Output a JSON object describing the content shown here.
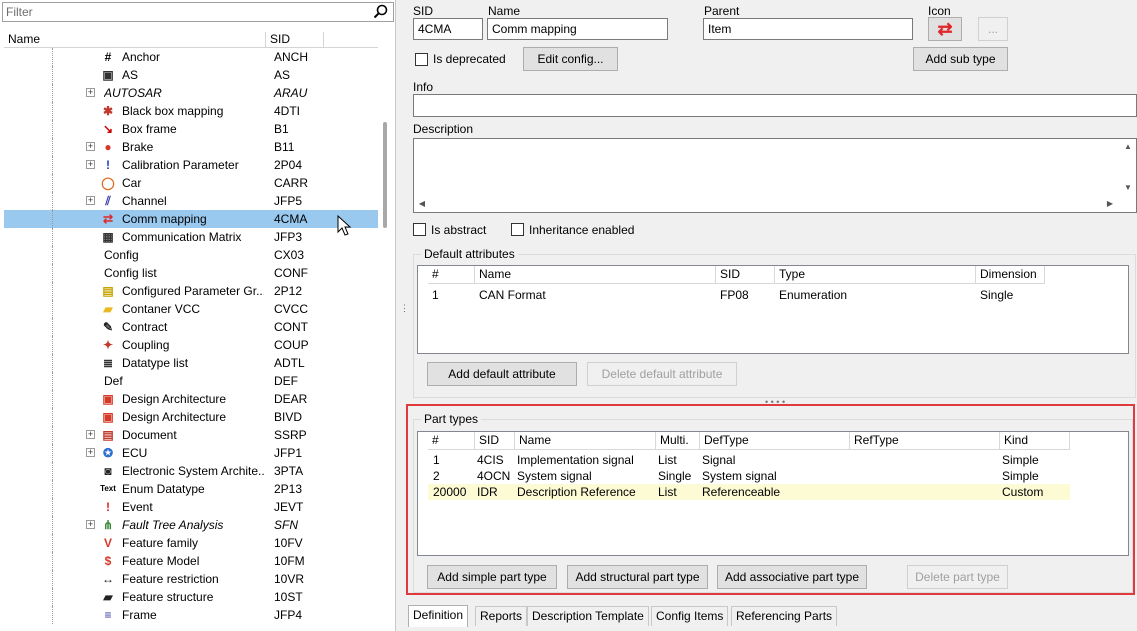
{
  "filter": {
    "placeholder": "Filter"
  },
  "tree": {
    "headers": {
      "name": "Name",
      "sid": "SID"
    },
    "rows": [
      {
        "name": "Anchor",
        "sid": "ANCH",
        "icon": "hash-icon",
        "glyph": "#",
        "color": "#000000"
      },
      {
        "name": "AS",
        "sid": "AS",
        "icon": "pano-icon",
        "glyph": "▣",
        "color": "#333333"
      },
      {
        "name": "AUTOSAR",
        "sid": "ARAU",
        "icon": "",
        "glyph": "",
        "color": "#000000"
      },
      {
        "name": "Black box mapping",
        "sid": "4DTI",
        "icon": "black-box-mapping-icon",
        "glyph": "✱",
        "color": "#c0392b"
      },
      {
        "name": "Box frame",
        "sid": "B1",
        "icon": "box-frame-icon",
        "glyph": "↘",
        "color": "#cc0000"
      },
      {
        "name": "Brake",
        "sid": "B11",
        "icon": "brake-icon",
        "glyph": "●",
        "color": "#d63a2b"
      },
      {
        "name": "Calibration Parameter",
        "sid": "2P04",
        "icon": "exclamation-icon",
        "glyph": "!",
        "color": "#1f3fbf"
      },
      {
        "name": "Car",
        "sid": "CARR",
        "icon": "car-icon",
        "glyph": "◯",
        "color": "#e2691f"
      },
      {
        "name": "Channel",
        "sid": "JFP5",
        "icon": "channel-icon",
        "glyph": "⫽",
        "color": "#3a3aa8"
      },
      {
        "name": "Comm mapping",
        "sid": "4CMA",
        "icon": "swap-arrows-icon",
        "glyph": "⇄",
        "color": "#e0262b"
      },
      {
        "name": "Communication Matrix",
        "sid": "JFP3",
        "icon": "communication-matrix-icon",
        "glyph": "▦",
        "color": "#333333"
      },
      {
        "name": "Config",
        "sid": "CX03",
        "icon": "",
        "glyph": "",
        "color": "#000000"
      },
      {
        "name": "Config list",
        "sid": "CONF",
        "icon": "",
        "glyph": "",
        "color": "#000000"
      },
      {
        "name": "Configured Parameter Gr...",
        "sid": "2P12",
        "icon": "configured-parameter-group-icon",
        "glyph": "▤",
        "color": "#c9a400"
      },
      {
        "name": "Contaner VCC",
        "sid": "CVCC",
        "icon": "folder-icon",
        "glyph": "▰",
        "color": "#e8b923"
      },
      {
        "name": "Contract",
        "sid": "CONT",
        "icon": "pen-icon",
        "glyph": "✎",
        "color": "#222222"
      },
      {
        "name": "Coupling",
        "sid": "COUP",
        "icon": "coupling-icon",
        "glyph": "✦",
        "color": "#c0392b"
      },
      {
        "name": "Datatype list",
        "sid": "ADTL",
        "icon": "datatype-list-icon",
        "glyph": "≣",
        "color": "#333333"
      },
      {
        "name": "Def",
        "sid": "DEF",
        "icon": "",
        "glyph": "",
        "color": "#000000"
      },
      {
        "name": "Design Architecture",
        "sid": "DEAR",
        "icon": "design-architecture-icon",
        "glyph": "▣",
        "color": "#d63a2b"
      },
      {
        "name": "Design Architecture",
        "sid": "BIVD",
        "icon": "design-architecture-icon",
        "glyph": "▣",
        "color": "#d63a2b"
      },
      {
        "name": "Document",
        "sid": "SSRP",
        "icon": "document-icon",
        "glyph": "▤",
        "color": "#c0392b"
      },
      {
        "name": "ECU",
        "sid": "JFP1",
        "icon": "ecu-icon",
        "glyph": "✪",
        "color": "#2b6fce"
      },
      {
        "name": "Electronic System Archite...",
        "sid": "3PTA",
        "icon": "camera-icon",
        "glyph": "◙",
        "color": "#222222"
      },
      {
        "name": "Enum Datatype",
        "sid": "2P13",
        "icon": "text-icon",
        "glyph": "Text",
        "color": "#000000"
      },
      {
        "name": "Event",
        "sid": "JEVT",
        "icon": "exclamation-icon",
        "glyph": "!",
        "color": "#e0262b"
      },
      {
        "name": "Fault Tree Analysis",
        "sid": "SFN",
        "icon": "fault-tree-icon",
        "glyph": "⋔",
        "color": "#3a8a3a"
      },
      {
        "name": "Feature family",
        "sid": "10FV",
        "icon": "feature-family-icon",
        "glyph": "V",
        "color": "#d63a2b"
      },
      {
        "name": "Feature Model",
        "sid": "10FM",
        "icon": "feature-model-icon",
        "glyph": "$",
        "color": "#d63a2b"
      },
      {
        "name": "Feature restriction",
        "sid": "10VR",
        "icon": "double-arrow-icon",
        "glyph": "↔",
        "color": "#222222"
      },
      {
        "name": "Feature structure",
        "sid": "10ST",
        "icon": "folder-icon",
        "glyph": "▰",
        "color": "#222222"
      },
      {
        "name": "Frame",
        "sid": "JFP4",
        "icon": "frame-icon",
        "glyph": "≡",
        "color": "#3a3aa8"
      }
    ]
  },
  "form": {
    "sid_label": "SID",
    "sid_value": "4CMA",
    "name_label": "Name",
    "name_value": "Comm mapping",
    "parent_label": "Parent",
    "parent_value": "Item",
    "icon_label": "Icon",
    "icon_glyph": "⇄",
    "icon_color": "#e0262b",
    "browse_label": "...",
    "is_deprecated": "Is deprecated",
    "edit_config": "Edit config...",
    "add_sub_type": "Add sub type",
    "info_label": "Info",
    "description_label": "Description",
    "is_abstract": "Is abstract",
    "inheritance_enabled": "Inheritance enabled"
  },
  "default_attributes": {
    "title": "Default attributes",
    "headers": [
      "#",
      "Name",
      "SID",
      "Type",
      "Dimension"
    ],
    "rows": [
      [
        "1",
        "CAN Format",
        "FP08",
        "Enumeration",
        "Single"
      ]
    ],
    "add_button": "Add default attribute",
    "delete_button": "Delete default attribute"
  },
  "part_types": {
    "title": "Part types",
    "headers": [
      "#",
      "SID",
      "Name",
      "Multi.",
      "DefType",
      "RefType",
      "Kind"
    ],
    "rows": [
      [
        "1",
        "4CIS",
        "Implementation signal",
        "List",
        "Signal",
        "",
        "Simple"
      ],
      [
        "2",
        "4OCN",
        "System signal",
        "Single",
        "System signal",
        "",
        "Simple"
      ],
      [
        "20000",
        "IDR",
        "Description Reference",
        "List",
        "Referenceable",
        "",
        "Custom"
      ]
    ],
    "add_simple": "Add simple part type",
    "add_structural": "Add structural part type",
    "add_associative": "Add associative part type",
    "delete_button": "Delete part type"
  },
  "tabs": [
    "Definition",
    "Reports",
    "Description Template",
    "Config Items",
    "Referencing Parts"
  ],
  "colors": {
    "selection": "#99c9ef",
    "highlight_border": "#e0393e",
    "custom_row": "#fdfbd4"
  }
}
